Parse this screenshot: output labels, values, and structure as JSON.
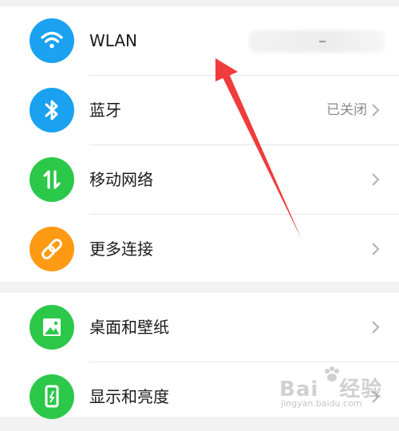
{
  "groups": [
    {
      "rows": [
        {
          "label": "WLAN",
          "value": "",
          "icon": "wifi-icon",
          "color": "#1aa1f0"
        },
        {
          "label": "蓝牙",
          "value": "已关闭",
          "icon": "bluetooth-icon",
          "color": "#1aa1f0"
        },
        {
          "label": "移动网络",
          "value": "",
          "icon": "mobile-data-icon",
          "color": "#2bc84a"
        },
        {
          "label": "更多连接",
          "value": "",
          "icon": "link-icon",
          "color": "#ff9a14"
        }
      ]
    },
    {
      "rows": [
        {
          "label": "桌面和壁纸",
          "value": "",
          "icon": "wallpaper-icon",
          "color": "#2bc84a"
        },
        {
          "label": "显示和亮度",
          "value": "",
          "icon": "display-icon",
          "color": "#2bc84a"
        }
      ]
    }
  ],
  "annotation": {
    "color": "#f03c3c"
  },
  "watermark": {
    "main": "Bai",
    "main2": "经验",
    "sub": "jingyan.baidu.com"
  }
}
